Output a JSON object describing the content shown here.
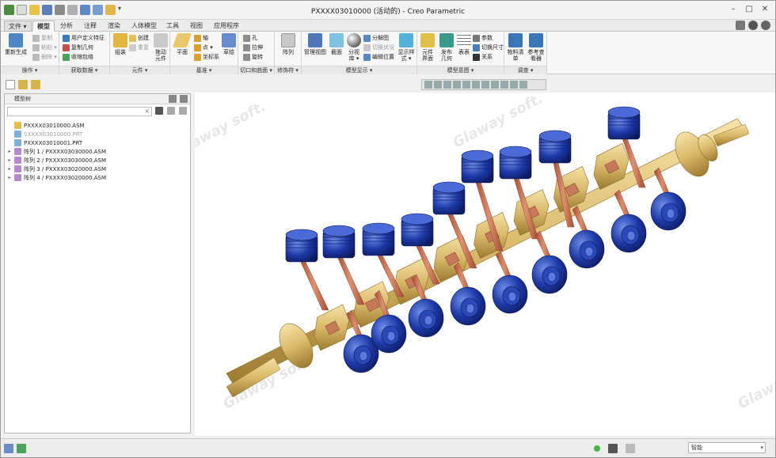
{
  "window": {
    "title": "PXXXX03010000 (活动的) - Creo Parametric"
  },
  "ribbon_tabs": [
    "文件 ▾",
    "模型",
    "分析",
    "注释",
    "渲染",
    "人体模型",
    "工具",
    "视图",
    "应用程序"
  ],
  "ribbon": {
    "operations": {
      "label": "操作 ▾",
      "regenerate": "重新生成",
      "copy": "复制",
      "paste": "粘贴 ▾",
      "delete": "删除 ▾"
    },
    "get_data": {
      "label": "获取数据 ▾",
      "udf": "用户定义特征",
      "copy_geom": "复制几何",
      "shrinkwrap": "收缩包络"
    },
    "component": {
      "label": "元件 ▾",
      "assemble": "组装",
      "create": "创建",
      "repeat": "重复",
      "drag": "拖动元件"
    },
    "datum": {
      "label": "基准 ▾",
      "plane": "平面",
      "axis": "轴",
      "point": "点 ▾",
      "csys": "坐标系",
      "sketch": "草绘"
    },
    "cut_surface": {
      "label": "切口和曲面 ▾",
      "hole": "孔",
      "extrude": "拉伸",
      "revolve": "旋转"
    },
    "modifiers": {
      "label": "修饰符 ▾",
      "pattern": "阵列"
    },
    "model_display": {
      "label": "模型显示 ▾",
      "manage_views": "管理视图",
      "section": "截面",
      "explode": "分解图",
      "edit_position": "编辑位置",
      "toggle_status": "切换状况",
      "exploded_lib": "分视库 ▾",
      "display_style": "显示样式 ▾"
    },
    "model_intent": {
      "label": "模型意图 ▾",
      "component_interface": "元件界面",
      "publish_geom": "发布几何",
      "table": "表表",
      "params": "参数",
      "toggle_dims": "切换尺寸",
      "relations": "关系"
    },
    "investigate": {
      "label": "调查 ▾",
      "bom": "物料清单",
      "reference_viewer": "参考查看器"
    }
  },
  "model_tree": {
    "header": "模型树",
    "search_placeholder": "",
    "items": [
      {
        "name": "PXXXX03010000.ASM",
        "expand": "",
        "dim": false,
        "icon": "assembly-icon"
      },
      {
        "name": "SXXXX03010000.PRT",
        "expand": "",
        "dim": true,
        "icon": "part-icon"
      },
      {
        "name": "PXXXX03010001.PRT",
        "expand": "",
        "dim": false,
        "icon": "part-icon"
      },
      {
        "name": "阵列 1 / PXXXX03030000.ASM",
        "expand": "▸",
        "dim": false,
        "icon": "pattern-icon"
      },
      {
        "name": "阵列 2 / PXXXX03030000.ASM",
        "expand": "▸",
        "dim": false,
        "icon": "pattern-icon"
      },
      {
        "name": "阵列 3 / PXXXX03020000.ASM",
        "expand": "▸",
        "dim": false,
        "icon": "pattern-icon"
      },
      {
        "name": "阵列 4 / PXXXX03020000.ASM",
        "expand": "▸",
        "dim": false,
        "icon": "pattern-icon"
      }
    ]
  },
  "viewport": {
    "watermark_brand": "Glaway soft.",
    "cylinders": 16
  },
  "statusbar": {
    "filter_value": "智能"
  },
  "colors": {
    "piston": "#1e3aa8",
    "rod": "#c46a4a",
    "crank": "#d9b96a"
  }
}
